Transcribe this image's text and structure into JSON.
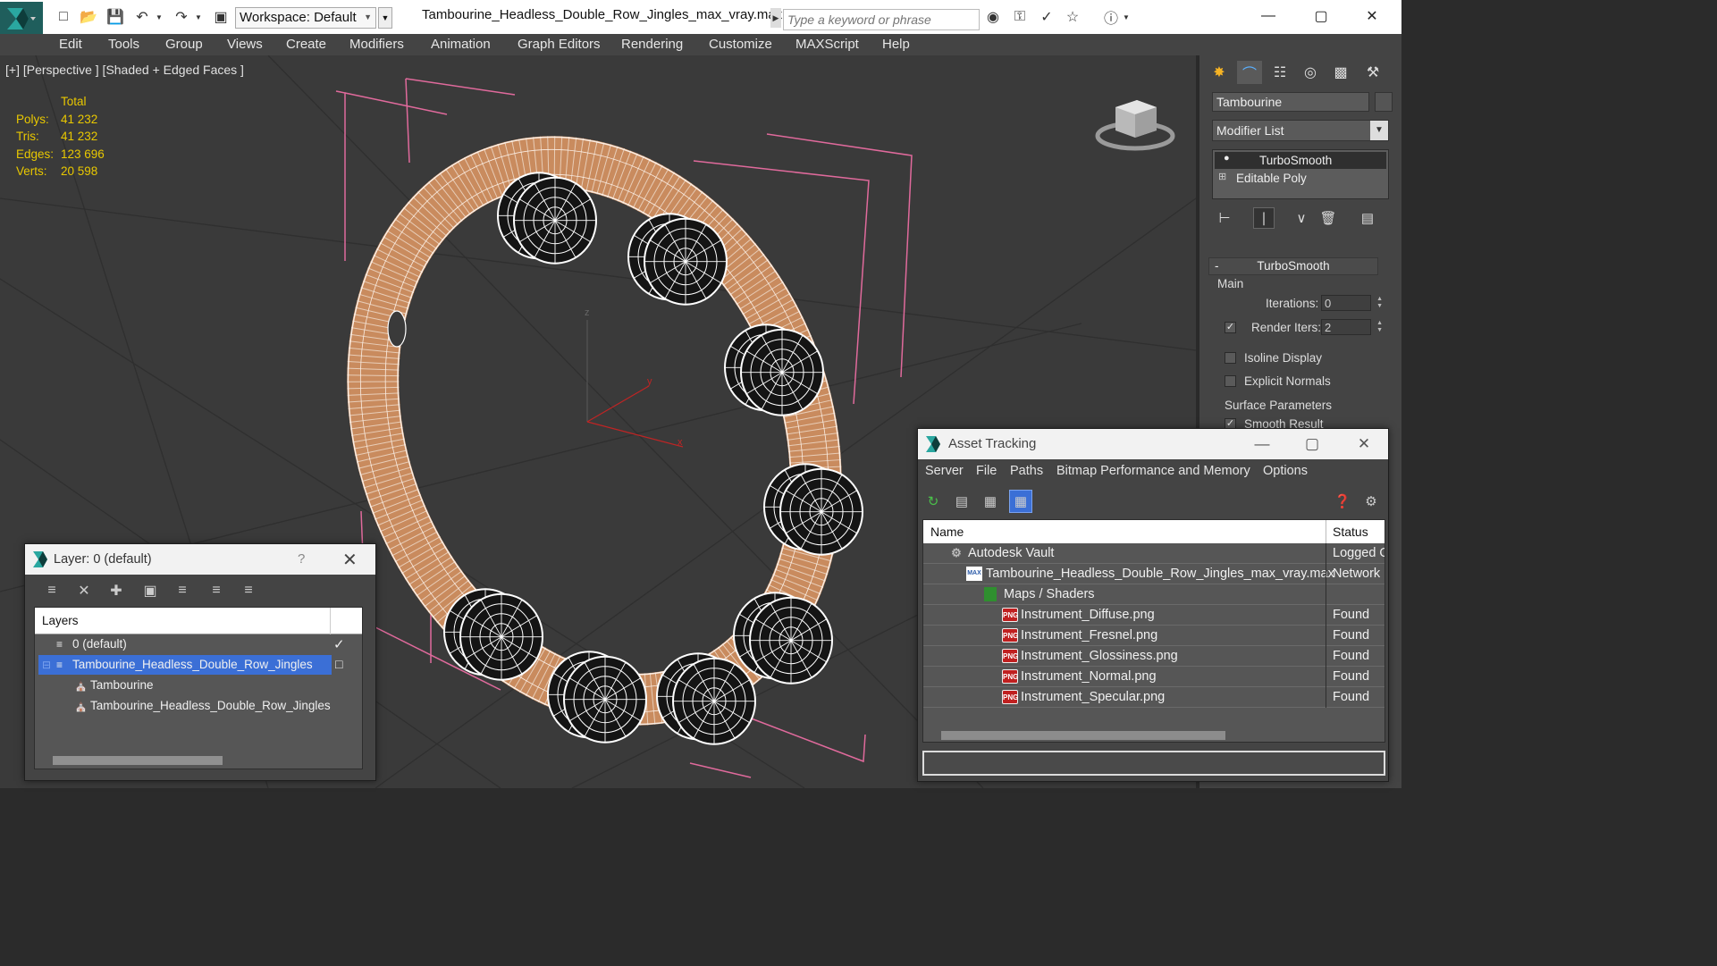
{
  "titlebar": {
    "workspace_label": "Workspace: Default",
    "document_title": "Tambourine_Headless_Double_Row_Jingles_max_vray.max",
    "search_placeholder": "Type a keyword or phrase",
    "minimize": "—",
    "maximize": "▢",
    "close": "✕"
  },
  "menubar": [
    "Edit",
    "Tools",
    "Group",
    "Views",
    "Create",
    "Modifiers",
    "Animation",
    "Graph Editors",
    "Rendering",
    "Customize",
    "MAXScript",
    "Help"
  ],
  "viewport": {
    "label": "[+] [Perspective ] [Shaded + Edged Faces ]",
    "stats": {
      "header": "Total",
      "rows": [
        {
          "key": "Polys:",
          "value": "41 232"
        },
        {
          "key": "Tris:",
          "value": "41 232"
        },
        {
          "key": "Edges:",
          "value": "123 696"
        },
        {
          "key": "Verts:",
          "value": "20 598"
        }
      ]
    },
    "axis_labels": {
      "z": "z",
      "y": "y",
      "x": "x"
    }
  },
  "command_panel": {
    "object_name": "Tambourine",
    "modifier_list_label": "Modifier List",
    "stack": [
      {
        "label": "TurboSmooth",
        "active": true
      },
      {
        "label": "Editable Poly",
        "active": false
      }
    ],
    "rollout": {
      "title": "TurboSmooth",
      "group_main": "Main",
      "iterations_label": "Iterations:",
      "iterations_value": "0",
      "render_iters_label": "Render Iters:",
      "render_iters_value": "2",
      "render_iters_checked": true,
      "isoline_label": "Isoline Display",
      "explicit_normals_label": "Explicit Normals",
      "surface_params_label": "Surface Parameters",
      "smooth_result_label": "Smooth Result"
    }
  },
  "layer_window": {
    "title": "Layer: 0 (default)",
    "help": "?",
    "close": "✕",
    "column_header": "Layers",
    "rows": [
      {
        "label": "0 (default)",
        "level": 0,
        "selected": false,
        "checked": true
      },
      {
        "label": "Tambourine_Headless_Double_Row_Jingles",
        "level": 0,
        "selected": true,
        "checked": false
      },
      {
        "label": "Tambourine",
        "level": 1,
        "selected": false,
        "checked": false
      },
      {
        "label": "Tambourine_Headless_Double_Row_Jingles",
        "level": 1,
        "selected": false,
        "checked": false
      }
    ]
  },
  "asset_window": {
    "title": "Asset Tracking",
    "menu": [
      "Server",
      "File",
      "Paths",
      "Bitmap Performance and Memory",
      "Options"
    ],
    "columns": {
      "name": "Name",
      "status": "Status"
    },
    "rows": [
      {
        "name": "Autodesk Vault",
        "status": "Logged Out",
        "icon": "vault-icon"
      },
      {
        "name": "Tambourine_Headless_Double_Row_Jingles_max_vray.max",
        "status": "Network",
        "icon": "max-file-icon"
      },
      {
        "name": "Maps / Shaders",
        "status": "",
        "icon": "maps-icon"
      },
      {
        "name": "Instrument_Diffuse.png",
        "status": "Found",
        "icon": "png-icon"
      },
      {
        "name": "Instrument_Fresnel.png",
        "status": "Found",
        "icon": "png-icon"
      },
      {
        "name": "Instrument_Glossiness.png",
        "status": "Found",
        "icon": "png-icon"
      },
      {
        "name": "Instrument_Normal.png",
        "status": "Found",
        "icon": "png-icon"
      },
      {
        "name": "Instrument_Specular.png",
        "status": "Found",
        "icon": "png-icon"
      }
    ],
    "png_badge": "PNG"
  },
  "colors": {
    "accent": "#3b6fd6",
    "stats": "#e9c800",
    "mesh": "#c98b5e",
    "bounding_box": "#e06a9c"
  }
}
